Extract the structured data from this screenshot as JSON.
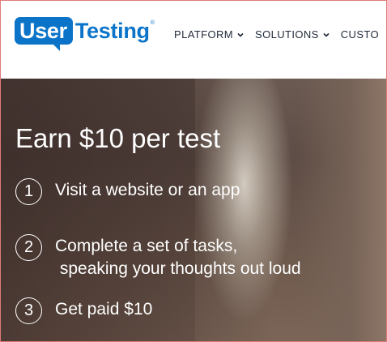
{
  "brand": {
    "name_boxed": "User",
    "name_plain": "Testing",
    "registered": "®",
    "color": "#0b74c9"
  },
  "nav": {
    "items": [
      {
        "label": "PLATFORM",
        "icon": "chevron-down-icon"
      },
      {
        "label": "SOLUTIONS",
        "icon": "chevron-down-icon"
      },
      {
        "label": "CUSTO",
        "icon": ""
      }
    ]
  },
  "hero": {
    "title": "Earn $10 per test",
    "steps": [
      {
        "number": "1",
        "lines": [
          "Visit a website or an app"
        ]
      },
      {
        "number": "2",
        "lines": [
          "Complete a set of tasks,",
          " speaking your thoughts out loud"
        ]
      },
      {
        "number": "3",
        "lines": [
          "Get paid $10"
        ]
      }
    ]
  }
}
